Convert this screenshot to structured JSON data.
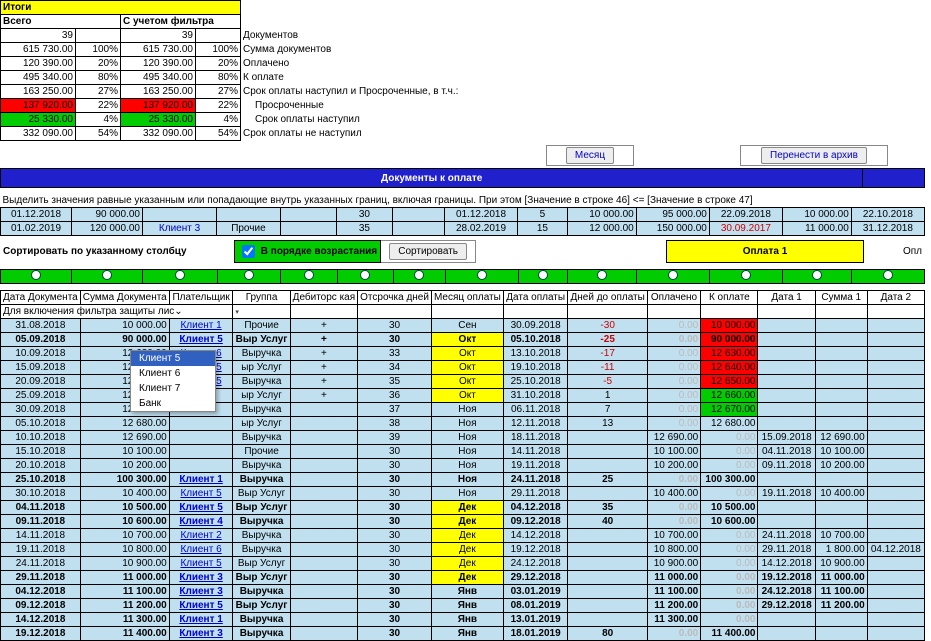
{
  "totals": {
    "header_itogi": "Итоги",
    "header_vsego": "Всего",
    "header_filter": "С учетом фильтра",
    "count_all": "39",
    "count_filter": "39",
    "labels": {
      "docs": "Документов",
      "sum_docs": "Сумма документов",
      "paid": "Оплачено",
      "topay": "К оплате",
      "due_overdue": "Срок оплаты наступил и Просроченные, в т.ч.:",
      "overdue": "Просроченные",
      "due": "Срок оплаты наступил",
      "not_due": "Срок оплаты не наступил"
    },
    "rows": [
      {
        "val": "615 730.00",
        "pct": "100%",
        "fval": "615 730.00",
        "fpct": "100%"
      },
      {
        "val": "120 390.00",
        "pct": "20%",
        "fval": "120 390.00",
        "fpct": "20%"
      },
      {
        "val": "495 340.00",
        "pct": "80%",
        "fval": "495 340.00",
        "fpct": "80%"
      },
      {
        "val": "163 250.00",
        "pct": "27%",
        "fval": "163 250.00",
        "fpct": "27%"
      },
      {
        "val": "137 920.00",
        "pct": "22%",
        "fval": "137 920.00",
        "fpct": "22%",
        "hl": "red"
      },
      {
        "val": "25 330.00",
        "pct": "4%",
        "fval": "25 330.00",
        "fpct": "4%",
        "hl": "green"
      },
      {
        "val": "332 090.00",
        "pct": "54%",
        "fval": "332 090.00",
        "fpct": "54%"
      }
    ]
  },
  "buttons": {
    "month": "Месяц",
    "archive": "Перенести в архив",
    "sort": "Сортировать"
  },
  "bar": {
    "docs_to_pay": "Документы к оплате"
  },
  "filter_hdr": {
    "line": "Выделить значения равные указанным или попадающие внутрь указанных границ, включая границы. При этом [Значение в строке 46] <= [Значение в строке 47]",
    "r1": {
      "date1": "01.12.2018",
      "sum": "90 000.00",
      "payer": "",
      "group": "",
      "deb": "",
      "delay": "30",
      "paymonth": "",
      "paydate": "01.12.2018",
      "days": "5",
      "paid": "10 000.00",
      "topay": "95 000.00",
      "d1": "22.09.2018",
      "s1": "10 000.00",
      "d2": "22.10.2018"
    },
    "r2": {
      "date1": "01.02.2019",
      "sum": "120 000.00",
      "payer": "Клиент 3",
      "group": "Прочие",
      "deb": "",
      "delay": "35",
      "paymonth": "",
      "paydate": "28.02.2019",
      "days": "15",
      "paid": "12 000.00",
      "topay": "150 000.00",
      "d1": "30.09.2017",
      "s1": "11 000.00",
      "d2": "31.12.2018"
    }
  },
  "sort_label": "Сортировать по указанному столбцу",
  "asc_checkbox": "В порядке возрастания",
  "oplata1": "Оплата 1",
  "opl_trunc": "Опл",
  "headers": {
    "docdate": "Дата Документа",
    "docsum": "Сумма Документа",
    "payer": "Плательщик",
    "group": "Группа",
    "deb": "Дебиторс кая",
    "delay": "Отсрочка дней",
    "paymonth": "Месяц оплаты",
    "paydate": "Дата оплаты",
    "days": "Дней до оплаты",
    "paid": "Оплачено",
    "topay": "К оплате",
    "date1": "Дата 1",
    "sum1": "Сумма 1",
    "date2": "Дата 2"
  },
  "protect_note": "Для включения фильтра защиты лис⌄",
  "dropdown": {
    "items": [
      "Клиент 5",
      "Клиент 6",
      "Клиент 7",
      "Банк"
    ],
    "selected": "Клиент 5"
  },
  "months": {
    "sen": "Сен",
    "okt": "Окт",
    "noy": "Ноя",
    "dek": "Дек",
    "yan": "Янв"
  },
  "rows": [
    {
      "d": "31.08.2018",
      "s": "10 000.00",
      "p": "Клиент 1",
      "g": "Прочие",
      "deb": "+",
      "dl": "30",
      "m": "Сен",
      "pd": "30.09.2018",
      "dd": "-30",
      "paid": "0.00",
      "tp": "10 000.00",
      "tp_hl": "red"
    },
    {
      "d": "05.09.2018",
      "s": "90 000.00",
      "p": "Клиент 5",
      "g": "Выр Услуг",
      "deb": "+",
      "dl": "30",
      "m": "Окт",
      "pd": "05.10.2018",
      "dd": "-25",
      "paid": "0.00",
      "tp": "90 000.00",
      "tp_hl": "red",
      "bold": true
    },
    {
      "d": "10.09.2018",
      "s": "12 630.00",
      "p": "Клиент 6",
      "g": "Выручка",
      "deb": "+",
      "dl": "33",
      "m": "Окт",
      "pd": "13.10.2018",
      "dd": "-17",
      "paid": "0.00",
      "tp": "12 630.00",
      "tp_hl": "red"
    },
    {
      "d": "15.09.2018",
      "s": "12 640.00",
      "p": "Клиент 5",
      "g": "ыр Услуг",
      "deb": "+",
      "dl": "34",
      "m": "Окт",
      "pd": "19.10.2018",
      "dd": "-11",
      "paid": "0.00",
      "tp": "12 640.00",
      "tp_hl": "red"
    },
    {
      "d": "20.09.2018",
      "s": "12 650.00",
      "p": "Клиент 5",
      "g": "Выручка",
      "deb": "+",
      "dl": "35",
      "m": "Окт",
      "pd": "25.10.2018",
      "dd": "-5",
      "paid": "0.00",
      "tp": "12 650.00",
      "tp_hl": "red",
      "dd_sel": true
    },
    {
      "d": "25.09.2018",
      "s": "12 660.00",
      "p": "",
      "g": "ыр Услуг",
      "deb": "+",
      "dl": "36",
      "m": "Окт",
      "pd": "31.10.2018",
      "dd": "1",
      "paid": "0.00",
      "tp": "12 660.00",
      "tp_hl": "green"
    },
    {
      "d": "30.09.2018",
      "s": "12 670.00",
      "p": "",
      "g": "Выручка",
      "deb": "",
      "dl": "37",
      "m": "Ноя",
      "pd": "06.11.2018",
      "dd": "7",
      "paid": "0.00",
      "tp": "12 670.00",
      "tp_hl": "green"
    },
    {
      "d": "05.10.2018",
      "s": "12 680.00",
      "p": "",
      "g": "ыр Услуг",
      "deb": "",
      "dl": "38",
      "m": "Ноя",
      "pd": "12.11.2018",
      "dd": "13",
      "paid": "0.00",
      "tp": "12 680.00"
    },
    {
      "d": "10.10.2018",
      "s": "12 690.00",
      "p": "",
      "g": "Выручка",
      "deb": "",
      "dl": "39",
      "m": "Ноя",
      "pd": "18.11.2018",
      "dd": "",
      "paid": "12 690.00",
      "tp": "0.00",
      "d1": "15.09.2018",
      "s1": "12 690.00"
    },
    {
      "d": "15.10.2018",
      "s": "10 100.00",
      "p": "",
      "g": "Прочие",
      "deb": "",
      "dl": "30",
      "m": "Ноя",
      "pd": "14.11.2018",
      "dd": "",
      "paid": "10 100.00",
      "tp": "0.00",
      "d1": "04.11.2018",
      "s1": "10 100.00"
    },
    {
      "d": "20.10.2018",
      "s": "10 200.00",
      "p": "",
      "g": "Выручка",
      "deb": "",
      "dl": "30",
      "m": "Ноя",
      "pd": "19.11.2018",
      "dd": "",
      "paid": "10 200.00",
      "tp": "0.00",
      "d1": "09.11.2018",
      "s1": "10 200.00"
    },
    {
      "d": "25.10.2018",
      "s": "100 300.00",
      "p": "Клиент 1",
      "g": "Выручка",
      "deb": "",
      "dl": "30",
      "m": "Ноя",
      "pd": "24.11.2018",
      "dd": "25",
      "paid": "0.00",
      "tp": "100 300.00",
      "bold": true
    },
    {
      "d": "30.10.2018",
      "s": "10 400.00",
      "p": "Клиент 5",
      "g": "Выр Услуг",
      "deb": "",
      "dl": "30",
      "m": "Ноя",
      "pd": "29.11.2018",
      "dd": "",
      "paid": "10 400.00",
      "tp": "0.00",
      "d1": "19.11.2018",
      "s1": "10 400.00"
    },
    {
      "d": "04.11.2018",
      "s": "10 500.00",
      "p": "Клиент 5",
      "g": "Выр Услуг",
      "deb": "",
      "dl": "30",
      "m": "Дек",
      "pd": "04.12.2018",
      "dd": "35",
      "paid": "0.00",
      "tp": "10 500.00",
      "bold": true
    },
    {
      "d": "09.11.2018",
      "s": "10 600.00",
      "p": "Клиент 4",
      "g": "Выручка",
      "deb": "",
      "dl": "30",
      "m": "Дек",
      "pd": "09.12.2018",
      "dd": "40",
      "paid": "0.00",
      "tp": "10 600.00",
      "bold": true
    },
    {
      "d": "14.11.2018",
      "s": "10 700.00",
      "p": "Клиент 2",
      "g": "Выручка",
      "deb": "",
      "dl": "30",
      "m": "Дек",
      "pd": "14.12.2018",
      "dd": "",
      "paid": "10 700.00",
      "tp": "0.00",
      "d1": "24.11.2018",
      "s1": "10 700.00"
    },
    {
      "d": "19.11.2018",
      "s": "10 800.00",
      "p": "Клиент 6",
      "g": "Выручка",
      "deb": "",
      "dl": "30",
      "m": "Дек",
      "pd": "19.12.2018",
      "dd": "",
      "paid": "10 800.00",
      "tp": "0.00",
      "d1": "29.11.2018",
      "s1": "1 800.00",
      "d2": "04.12.2018"
    },
    {
      "d": "24.11.2018",
      "s": "10 900.00",
      "p": "Клиент 5",
      "g": "Выр Услуг",
      "deb": "",
      "dl": "30",
      "m": "Дек",
      "pd": "24.12.2018",
      "dd": "",
      "paid": "10 900.00",
      "tp": "0.00",
      "d1": "14.12.2018",
      "s1": "10 900.00"
    },
    {
      "d": "29.11.2018",
      "s": "11 000.00",
      "p": "Клиент 3",
      "g": "Выр Услуг",
      "deb": "",
      "dl": "30",
      "m": "Дек",
      "pd": "29.12.2018",
      "dd": "",
      "paid": "11 000.00",
      "tp": "0.00",
      "d1": "19.12.2018",
      "s1": "11 000.00",
      "bold": true
    },
    {
      "d": "04.12.2018",
      "s": "11 100.00",
      "p": "Клиент 3",
      "g": "Выручка",
      "deb": "",
      "dl": "30",
      "m": "Янв",
      "pd": "03.01.2019",
      "dd": "",
      "paid": "11 100.00",
      "tp": "0.00",
      "d1": "24.12.2018",
      "s1": "11 100.00",
      "bold": true
    },
    {
      "d": "09.12.2018",
      "s": "11 200.00",
      "p": "Клиент 5",
      "g": "Выр Услуг",
      "deb": "",
      "dl": "30",
      "m": "Янв",
      "pd": "08.01.2019",
      "dd": "",
      "paid": "11 200.00",
      "tp": "0.00",
      "d1": "29.12.2018",
      "s1": "11 200.00",
      "bold": true
    },
    {
      "d": "14.12.2018",
      "s": "11 300.00",
      "p": "Клиент 1",
      "g": "Выручка",
      "deb": "",
      "dl": "30",
      "m": "Янв",
      "pd": "13.01.2019",
      "dd": "",
      "paid": "11 300.00",
      "tp": "0.00",
      "bold": true
    },
    {
      "d": "19.12.2018",
      "s": "11 400.00",
      "p": "Клиент 3",
      "g": "Выручка",
      "deb": "",
      "dl": "30",
      "m": "Янв",
      "pd": "18.01.2019",
      "dd": "80",
      "paid": "0.00",
      "tp": "11 400.00",
      "bold": true
    }
  ]
}
